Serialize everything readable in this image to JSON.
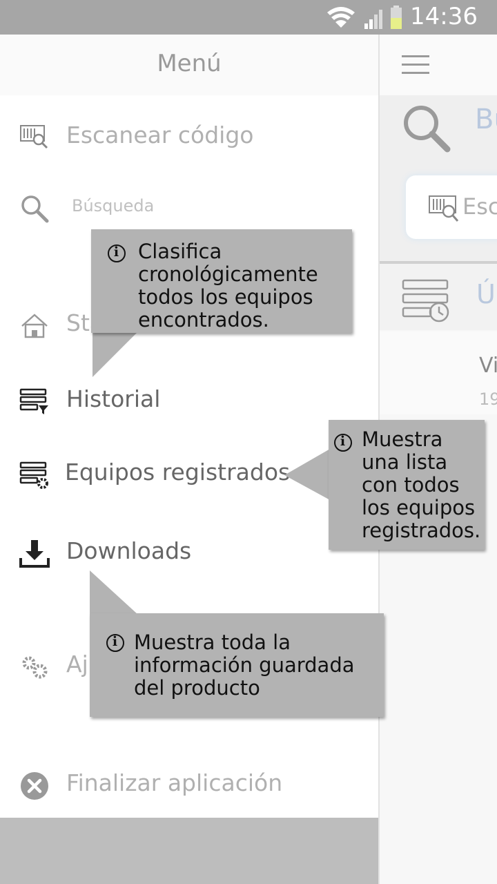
{
  "status_bar": {
    "time": "14:36"
  },
  "drawer": {
    "title": "Menú",
    "items": [
      {
        "label": "Escanear código",
        "icon": "barcode-scan-icon"
      },
      {
        "label": "Búsqueda",
        "icon": "search-icon"
      },
      {
        "label": "Sta",
        "icon": "home-icon"
      },
      {
        "label": "Historial",
        "icon": "history-filter-icon"
      },
      {
        "label": "Equipos registrados",
        "icon": "registered-devices-icon"
      },
      {
        "label": "Downloads",
        "icon": "download-icon"
      },
      {
        "label": "Aju",
        "icon": "gear-icon"
      },
      {
        "label": "Finalizar aplicación",
        "icon": "close-circle-icon"
      }
    ]
  },
  "main": {
    "search_title": "Bu",
    "scan_placeholder": "Esc",
    "recent_title": "Ú",
    "list_item": {
      "line1": "Vi",
      "line2": "19"
    }
  },
  "callouts": {
    "historial": "Clasifica cronológicamente todos los equipos encontrados.",
    "equipos": "Muestra una lista con todos los equipos registrados.",
    "downloads": "Muestra toda la información guardada del producto"
  },
  "colors": {
    "status_bar": "#a6a6a6",
    "callout_bg": "#b3b3b3",
    "accent_text": "#b9c8de"
  }
}
